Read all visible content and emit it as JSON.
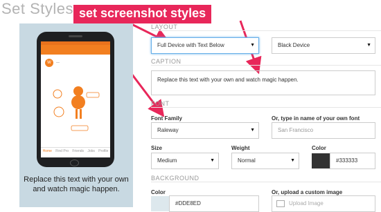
{
  "page_title": "Set Styles",
  "annotation": "set screenshot styles",
  "preview": {
    "caption": "Replace this text with your own and watch magic happen.",
    "app_tabs": [
      "Home",
      "Find Pro",
      "Friends",
      "Jobs",
      "Profile"
    ]
  },
  "layout": {
    "section_label": "LAYOUT",
    "layout_select": "Full Device with Text Below",
    "device_select": "Black Device"
  },
  "caption": {
    "section_label": "CAPTION",
    "text": "Replace this text with your own and watch magic happen."
  },
  "font": {
    "section_label": "FONT",
    "family_label": "Font Family",
    "family_value": "Raleway",
    "custom_label": "Or, type in name of your own font",
    "custom_placeholder": "San Francisco",
    "size_label": "Size",
    "size_value": "Medium",
    "weight_label": "Weight",
    "weight_value": "Normal",
    "color_label": "Color",
    "color_value": "#333333"
  },
  "background": {
    "section_label": "BACKGROUND",
    "color_label": "Color",
    "color_value": "#DDE8ED",
    "upload_label": "Or, upload a custom image",
    "upload_button": "Upload Image"
  },
  "colors": {
    "annotation": "#e8275a",
    "accent": "#f27f20",
    "preview_bg": "#c8d9e2",
    "font_swatch": "#333333",
    "bg_swatch": "#DDE8ED"
  }
}
